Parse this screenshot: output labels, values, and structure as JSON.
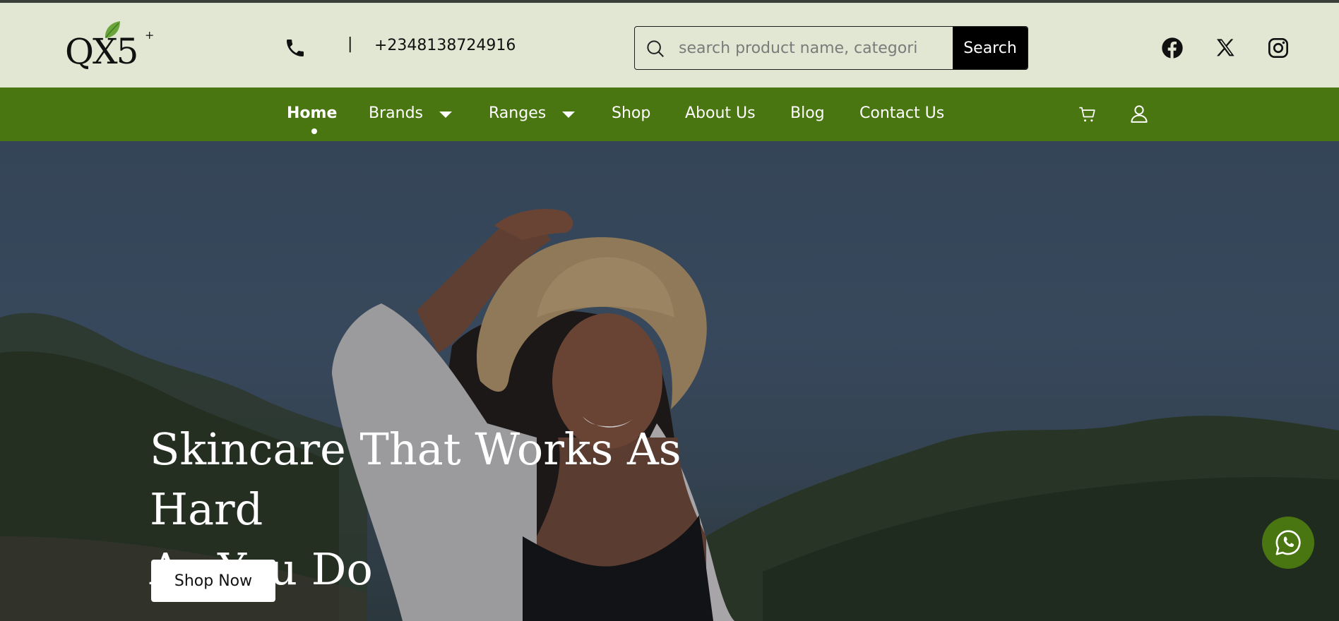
{
  "header": {
    "logo_text": "QX5",
    "logo_superscript": "+",
    "phone_separator": "|",
    "phone_number": "+2348138724916",
    "search": {
      "placeholder": "search product name, categori",
      "button_label": "Search"
    },
    "social_icons": [
      "facebook-icon",
      "x-icon",
      "instagram-icon"
    ]
  },
  "nav": {
    "items": [
      {
        "label": "Home",
        "active": true
      },
      {
        "label": "Brands",
        "dropdown": true
      },
      {
        "label": "Ranges",
        "dropdown": true
      },
      {
        "label": "Shop"
      },
      {
        "label": "About Us"
      },
      {
        "label": "Blog"
      },
      {
        "label": "Contact Us"
      }
    ],
    "right_icons": [
      "cart-icon",
      "user-icon"
    ]
  },
  "hero": {
    "title_line1": "Skincare That Works As Hard",
    "title_line2": "As You Do",
    "cta_label": "Shop Now"
  },
  "floating": {
    "icon": "whatsapp-icon"
  },
  "colors": {
    "header_bg": "#e1e7d2",
    "nav_bg": "#4a7611",
    "accent": "#4a7611",
    "button_dark": "#000000"
  }
}
